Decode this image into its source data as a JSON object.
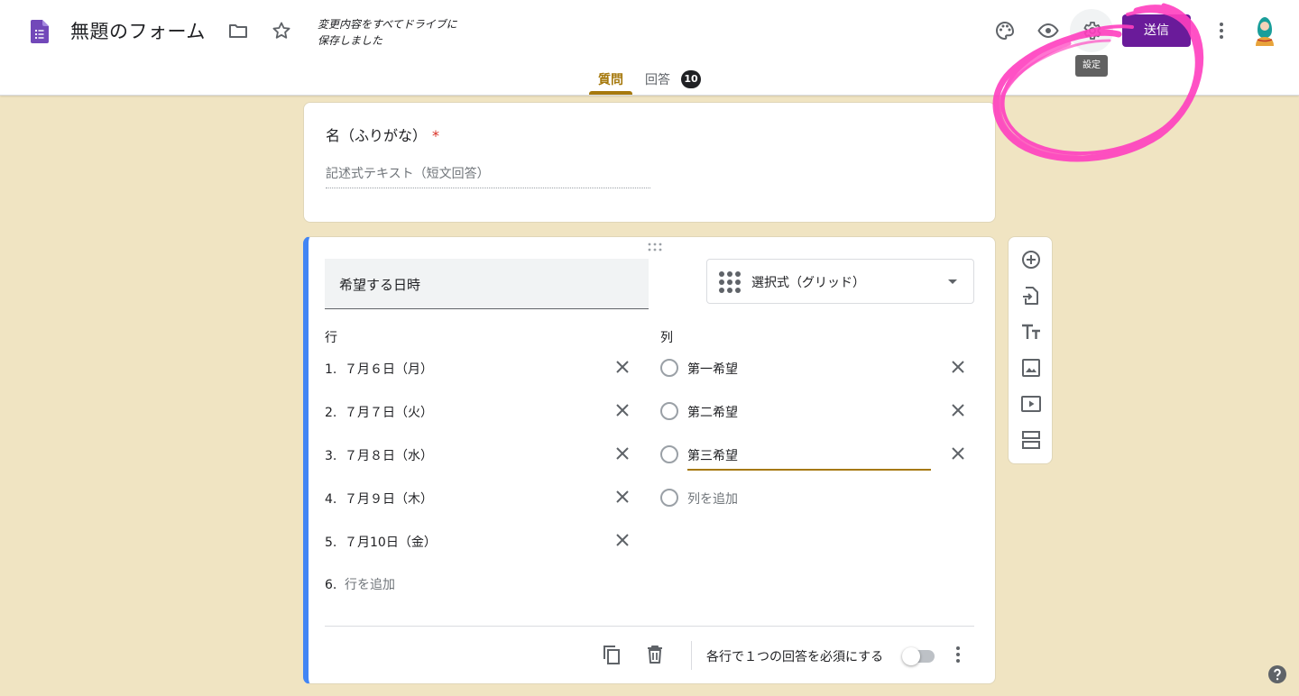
{
  "header": {
    "title": "無題のフォーム",
    "save_status_line1": "変更内容をすべてドライブに",
    "save_status_line2": "保存しました",
    "settings_tooltip": "設定",
    "send_label": "送信",
    "icons": [
      "forms-app-icon",
      "folder-icon",
      "star-icon",
      "palette-icon",
      "preview-eye-icon",
      "settings-gear-icon",
      "more-vert-icon",
      "avatar"
    ],
    "tabs": [
      {
        "label": "質問",
        "active": true
      },
      {
        "label": "回答",
        "count": "10"
      }
    ]
  },
  "question1": {
    "title": "名（ふりがな）",
    "required_mark": "*",
    "answer_placeholder": "記述式テキスト（短文回答）"
  },
  "question2": {
    "title": "希望する日時",
    "type_label": "選択式（グリッド）",
    "rows_header": "行",
    "columns_header": "列",
    "rows": [
      {
        "num": "1.",
        "label": "７月６日（月）"
      },
      {
        "num": "2.",
        "label": "７月７日（火）"
      },
      {
        "num": "3.",
        "label": "７月８日（水）"
      },
      {
        "num": "4.",
        "label": "７月９日（木）"
      },
      {
        "num": "5.",
        "label": "７月10日（金）"
      }
    ],
    "add_row": {
      "num": "6.",
      "label": "行を追加"
    },
    "columns": [
      "第一希望",
      "第二希望",
      "第三希望"
    ],
    "add_column": "列を追加",
    "footer_label": "各行で１つの回答を必須にする",
    "require_toggle_on": false
  },
  "side_toolbar": [
    "add-question-icon",
    "import-questions-icon",
    "add-title-icon",
    "add-image-icon",
    "add-video-icon",
    "add-section-icon"
  ],
  "colors": {
    "background": "#f0e4c2",
    "accent": "#a6790d",
    "send_button": "#6a1b9a",
    "active_card_border": "#4285f4",
    "annotation": "#ff3fbf"
  }
}
